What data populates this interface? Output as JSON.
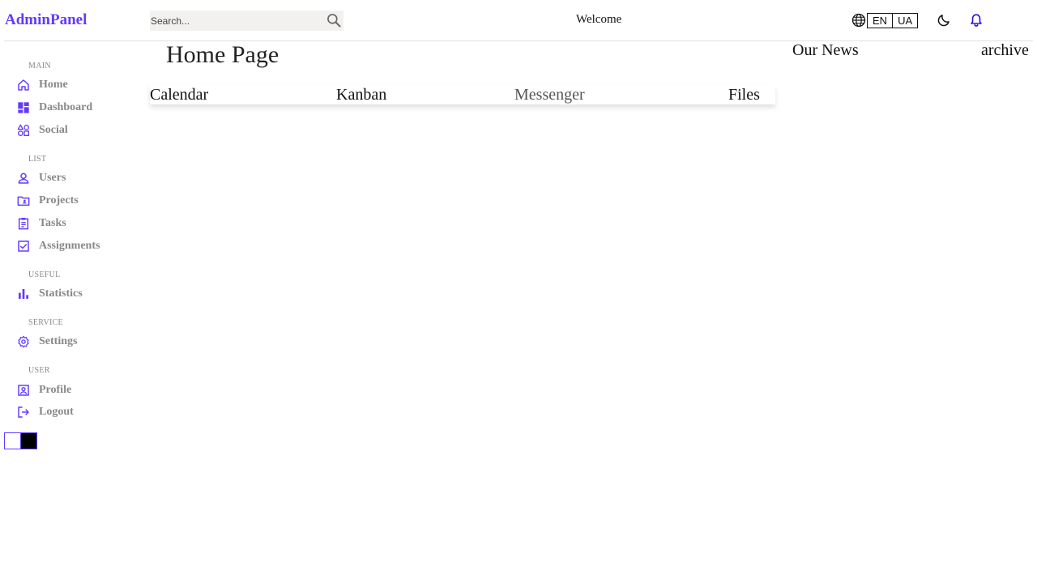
{
  "header": {
    "logo": "AdminPanel",
    "search_placeholder": "Search...",
    "welcome": "Welcome",
    "languages": [
      "EN",
      "UA"
    ]
  },
  "sidebar": {
    "sections": [
      {
        "title": "MAIN",
        "items": [
          {
            "label": "Home",
            "icon": "home-icon"
          },
          {
            "label": "Dashboard",
            "icon": "dashboard-icon"
          },
          {
            "label": "Social",
            "icon": "category-icon"
          }
        ]
      },
      {
        "title": "LIST",
        "items": [
          {
            "label": "Users",
            "icon": "user-icon"
          },
          {
            "label": "Projects",
            "icon": "folder-icon"
          },
          {
            "label": "Tasks",
            "icon": "clipboard-icon"
          },
          {
            "label": "Assignments",
            "icon": "checkbox-icon"
          }
        ]
      },
      {
        "title": "USEFUL",
        "items": [
          {
            "label": "Statistics",
            "icon": "bar-chart-icon"
          }
        ]
      },
      {
        "title": "SERVICE",
        "items": [
          {
            "label": "Settings",
            "icon": "gear-icon"
          }
        ]
      },
      {
        "title": "USER",
        "items": [
          {
            "label": "Profile",
            "icon": "profile-icon"
          },
          {
            "label": "Logout",
            "icon": "logout-icon"
          }
        ]
      }
    ]
  },
  "main": {
    "title": "Home Page",
    "apps": [
      "Calendar",
      "Kanban",
      "Messenger",
      "Files"
    ]
  },
  "news": {
    "title": "Our News",
    "archive_label": "archive"
  },
  "colors": {
    "accent": "#6439ff",
    "bell": "#2a10e0",
    "muted_text": "#888888"
  }
}
